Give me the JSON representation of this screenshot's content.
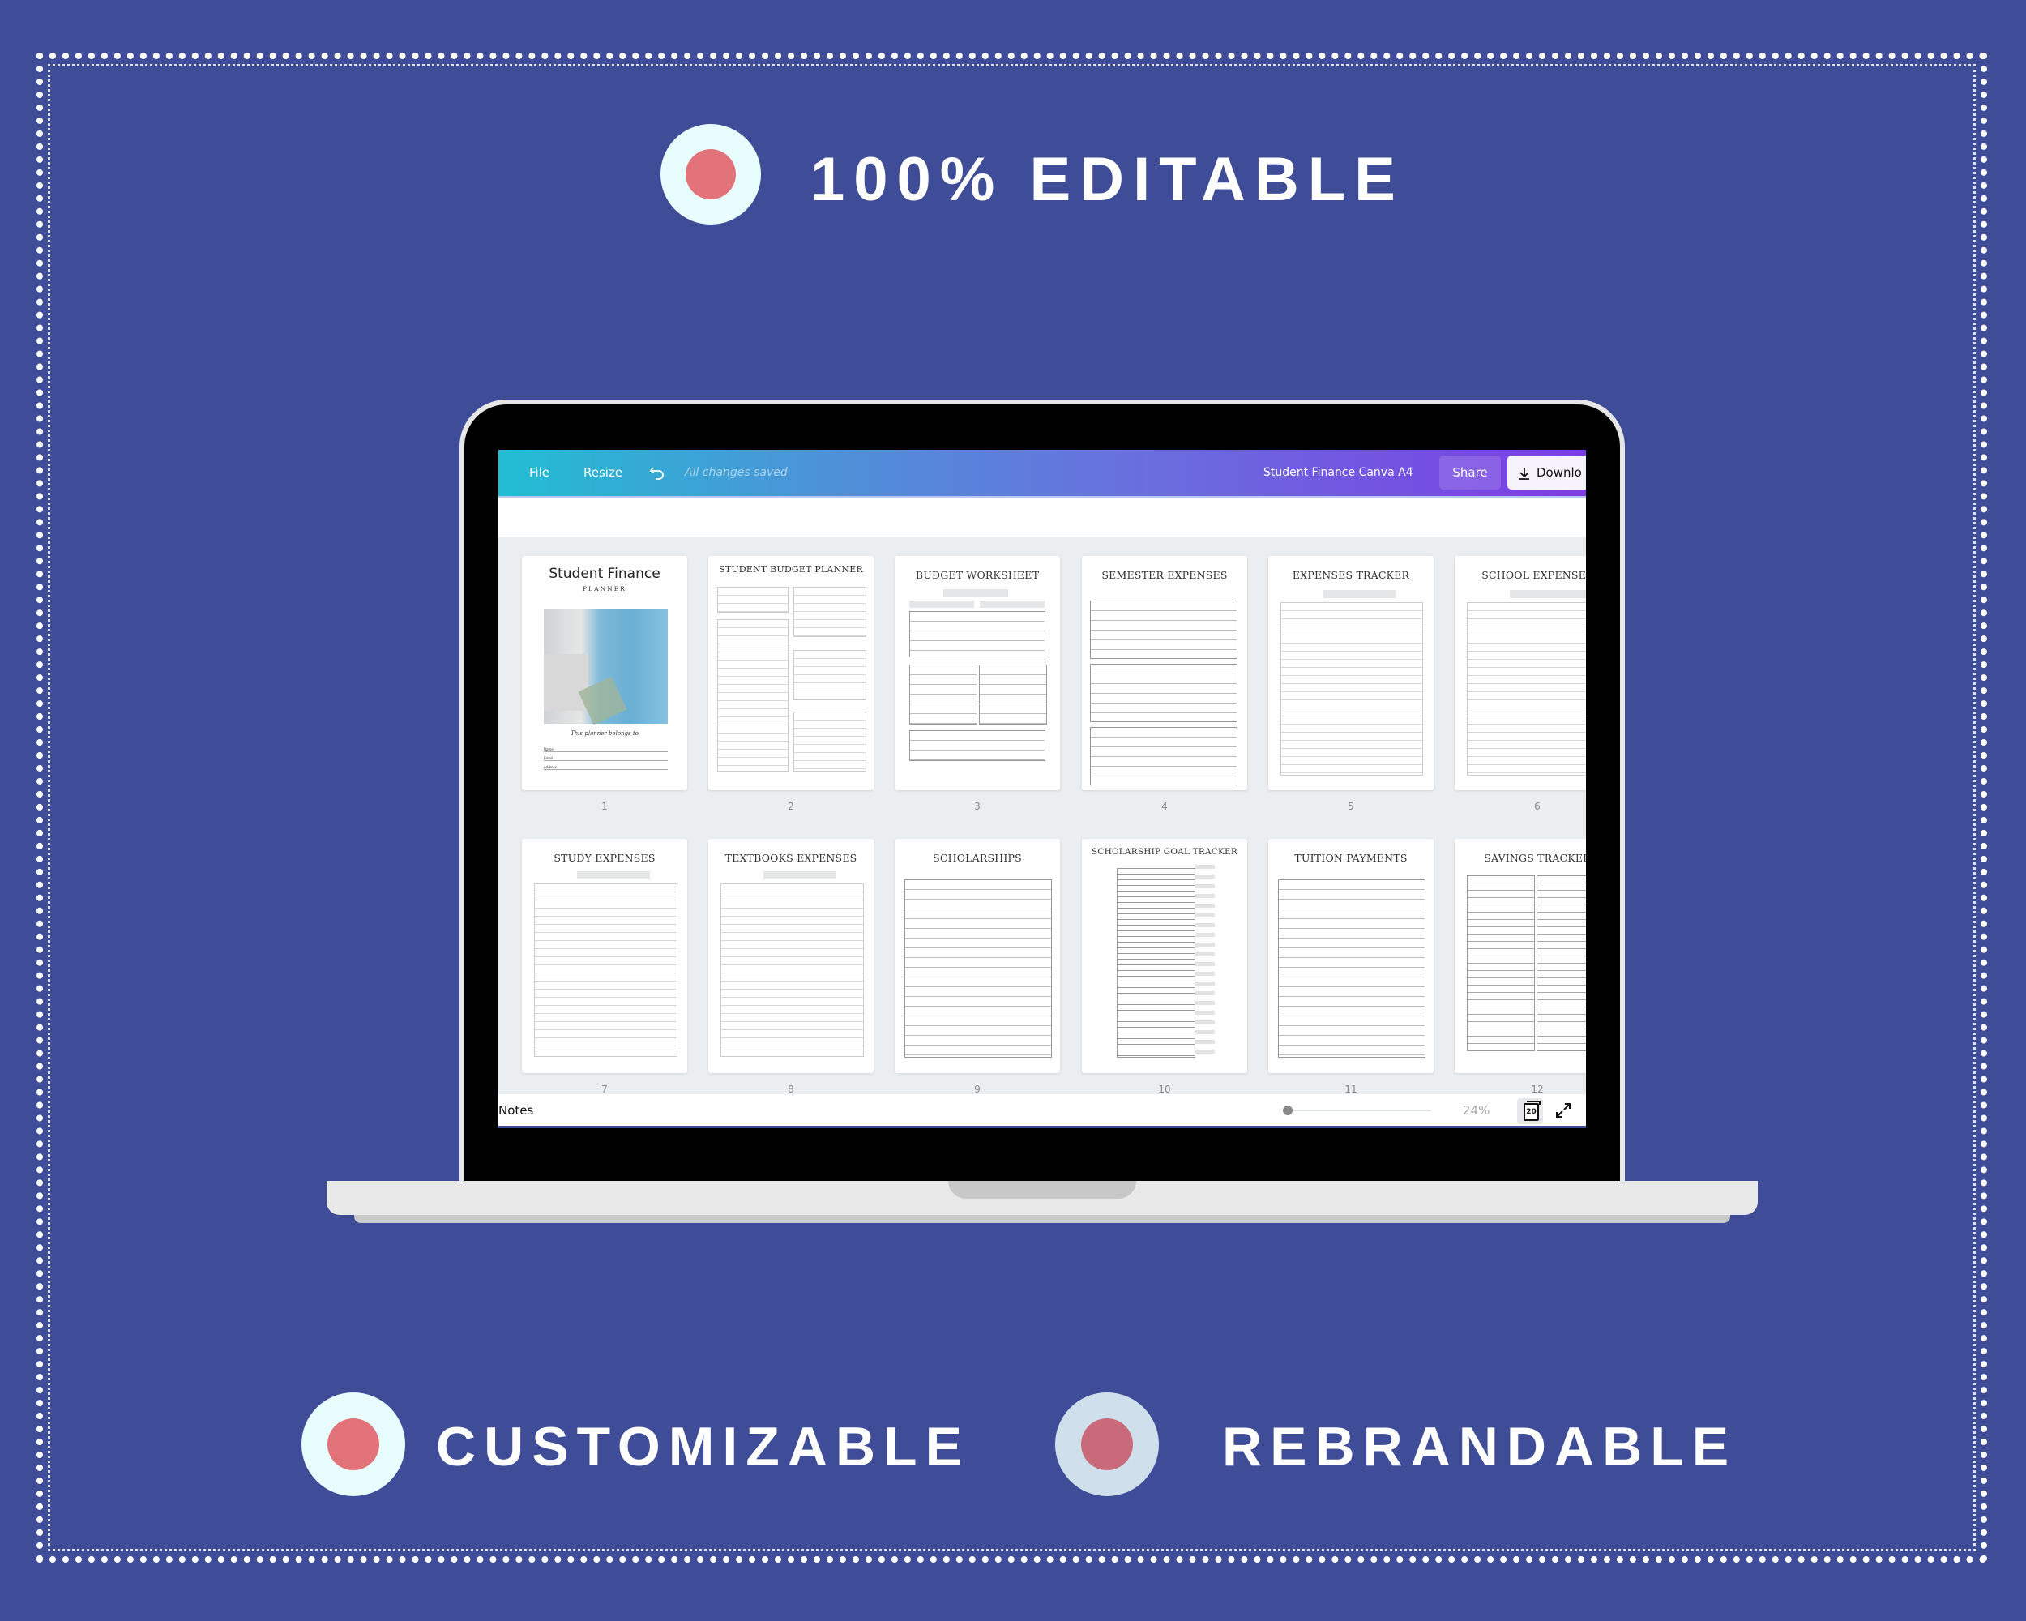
{
  "features": {
    "top": {
      "label": "100% EDITABLE"
    },
    "bottom_left": {
      "label": "CUSTOMIZABLE"
    },
    "bottom_right": {
      "label": "REBRANDABLE"
    }
  },
  "colors": {
    "background": "#3F4D98",
    "badge_outer": "#E8FDFD",
    "badge_outer_alt": "#CFE0EC",
    "badge_inner": "#E3737A",
    "badge_inner_alt": "#C86A7A",
    "toolbar_start": "#22BDD3",
    "toolbar_end": "#7B3EE4"
  },
  "editor": {
    "toolbar": {
      "file": "File",
      "resize": "Resize",
      "undo_icon": "undo-icon",
      "save_status": "All changes saved",
      "doc_title": "Student Finance Canva A4",
      "share": "Share",
      "download": "Downlo",
      "download_icon": "download-icon"
    },
    "pages": [
      {
        "num": "1",
        "title": "Student Finance",
        "subtitle": "PLANNER",
        "belongs": "This planner belongs to",
        "fields": [
          "Name",
          "Email",
          "Address"
        ]
      },
      {
        "num": "2",
        "title": "STUDENT BUDGET PLANNER"
      },
      {
        "num": "3",
        "title": "BUDGET WORKSHEET"
      },
      {
        "num": "4",
        "title": "SEMESTER EXPENSES"
      },
      {
        "num": "5",
        "title": "EXPENSES TRACKER"
      },
      {
        "num": "6",
        "title": "SCHOOL EXPENSES"
      },
      {
        "num": "7",
        "title": "STUDY EXPENSES"
      },
      {
        "num": "8",
        "title": "TEXTBOOKS EXPENSES"
      },
      {
        "num": "9",
        "title": "SCHOLARSHIPS"
      },
      {
        "num": "10",
        "title": "SCHOLARSHIP GOAL TRACKER"
      },
      {
        "num": "11",
        "title": "TUITION PAYMENTS"
      },
      {
        "num": "12",
        "title": "SAVINGS TRACKER"
      }
    ],
    "bottom_bar": {
      "notes": "Notes",
      "zoom_percent": "24%",
      "zoom_slider_value": 0.0,
      "page_count": "20",
      "expand_icon": "expand-icon"
    }
  }
}
